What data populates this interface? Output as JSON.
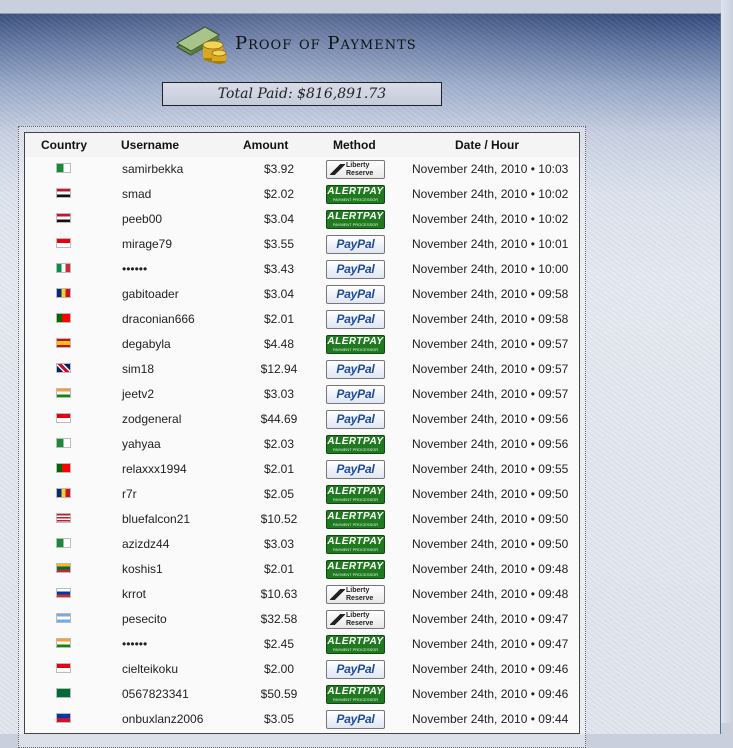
{
  "title": "Proof of Payments",
  "total_paid": "Total Paid: $816,891.73",
  "table": {
    "headers": {
      "country": "Country",
      "username": "Username",
      "amount": "Amount",
      "method": "Method",
      "date": "Date / Hour"
    },
    "methods": {
      "paypal": {
        "label": "PayPal"
      },
      "alertpay": {
        "label": "ALERTPAY",
        "sub": "PAYMENT PROCESSOR"
      },
      "liberty": {
        "label": "Liberty Reserve"
      }
    },
    "rows": [
      {
        "flag": "algeria",
        "username": "samirbekka",
        "amount": "$3.92",
        "method": "liberty",
        "date": "November 24th, 2010 • 10:03"
      },
      {
        "flag": "egypt",
        "username": "smad",
        "amount": "$2.02",
        "method": "alertpay",
        "date": "November 24th, 2010 • 10:02"
      },
      {
        "flag": "iraq",
        "username": "peeb00",
        "amount": "$3.04",
        "method": "alertpay",
        "date": "November 24th, 2010 • 10:02"
      },
      {
        "flag": "indonesia",
        "username": "mirage79",
        "amount": "$3.55",
        "method": "paypal",
        "date": "November 24th, 2010 • 10:01"
      },
      {
        "flag": "italy",
        "username": "••••••",
        "amount": "$3.43",
        "method": "paypal",
        "date": "November 24th, 2010 • 10:00"
      },
      {
        "flag": "romania",
        "username": "gabitoader",
        "amount": "$3.04",
        "method": "paypal",
        "date": "November 24th, 2010 • 09:58"
      },
      {
        "flag": "portugal",
        "username": "draconian666",
        "amount": "$2.01",
        "method": "paypal",
        "date": "November 24th, 2010 • 09:58"
      },
      {
        "flag": "spain",
        "username": "degabyla",
        "amount": "$4.48",
        "method": "alertpay",
        "date": "November 24th, 2010 • 09:57"
      },
      {
        "flag": "uk",
        "username": "sim18",
        "amount": "$12.94",
        "method": "paypal",
        "date": "November 24th, 2010 • 09:57"
      },
      {
        "flag": "india",
        "username": "jeetv2",
        "amount": "$3.03",
        "method": "paypal",
        "date": "November 24th, 2010 • 09:57"
      },
      {
        "flag": "indonesia",
        "username": "zodgeneral",
        "amount": "$44.69",
        "method": "paypal",
        "date": "November 24th, 2010 • 09:56"
      },
      {
        "flag": "algeria",
        "username": "yahyaa",
        "amount": "$2.03",
        "method": "alertpay",
        "date": "November 24th, 2010 • 09:56"
      },
      {
        "flag": "portugal",
        "username": "relaxxx1994",
        "amount": "$2.01",
        "method": "paypal",
        "date": "November 24th, 2010 • 09:55"
      },
      {
        "flag": "romania",
        "username": "r7r",
        "amount": "$2.05",
        "method": "alertpay",
        "date": "November 24th, 2010 • 09:50"
      },
      {
        "flag": "usa",
        "username": "bluefalcon21",
        "amount": "$10.52",
        "method": "alertpay",
        "date": "November 24th, 2010 • 09:50"
      },
      {
        "flag": "algeria",
        "username": "azizdz44",
        "amount": "$3.03",
        "method": "alertpay",
        "date": "November 24th, 2010 • 09:50"
      },
      {
        "flag": "lithuania",
        "username": "koshis1",
        "amount": "$2.01",
        "method": "alertpay",
        "date": "November 24th, 2010 • 09:48"
      },
      {
        "flag": "russia",
        "username": "krrot",
        "amount": "$10.63",
        "method": "liberty",
        "date": "November 24th, 2010 • 09:48"
      },
      {
        "flag": "argentina",
        "username": "pesecito",
        "amount": "$32.58",
        "method": "liberty",
        "date": "November 24th, 2010 • 09:47"
      },
      {
        "flag": "india",
        "username": "••••••",
        "amount": "$2.45",
        "method": "alertpay",
        "date": "November 24th, 2010 • 09:47"
      },
      {
        "flag": "indonesia",
        "username": "cielteikoku",
        "amount": "$2.00",
        "method": "paypal",
        "date": "November 24th, 2010 • 09:46"
      },
      {
        "flag": "saudi",
        "username": "0567823341",
        "amount": "$50.59",
        "method": "alertpay",
        "date": "November 24th, 2010 • 09:46"
      },
      {
        "flag": "philippines",
        "username": "onbuxlanz2006",
        "amount": "$3.05",
        "method": "paypal",
        "date": "November 24th, 2010 • 09:44"
      }
    ]
  },
  "flag_styles": {
    "algeria": "linear-gradient(90deg,#1a8a3a 0 50%,#ffffff 50% 100%)",
    "egypt": "linear-gradient(180deg,#ce1126 0 33%,#ffffff 33% 66%,#111 66%)",
    "iraq": "linear-gradient(180deg,#ce1126 0 33%,#ffffff 33% 66%,#111 66%)",
    "indonesia": "linear-gradient(180deg,#e70011 0 50%,#ffffff 50%)",
    "italy": "linear-gradient(90deg,#009246 0 33%,#ffffff 33% 66%,#ce2b37 66%)",
    "romania": "linear-gradient(90deg,#002b7f 0 33%,#fcd116 33% 66%,#ce1126 66%)",
    "portugal": "linear-gradient(90deg,#006600 0 40%,#ff0000 40%)",
    "spain": "linear-gradient(180deg,#c60b1e 0 25%,#ffc400 25% 75%,#c60b1e 75%)",
    "uk": "linear-gradient(45deg,#012169 0 30%,#ffffff 30% 40%,#c8102e 40% 60%,#ffffff 60% 70%,#012169 70%)",
    "india": "linear-gradient(180deg,#ff9933 0 33%,#ffffff 33% 66%,#138808 66%)",
    "usa": "repeating-linear-gradient(180deg,#b22234 0 1.5px,#ffffff 1.5px 3px)",
    "lithuania": "linear-gradient(180deg,#fdb913 0 33%,#006a44 33% 66%,#c1272d 66%)",
    "russia": "linear-gradient(180deg,#ffffff 0 33%,#0039a6 33% 66%,#d52b1e 66%)",
    "argentina": "linear-gradient(180deg,#74acdf 0 33%,#ffffff 33% 66%,#74acdf 66%)",
    "saudi": "linear-gradient(180deg,#006c35,#006c35)",
    "philippines": "linear-gradient(180deg,#0038a8 0 50%,#ce1126 50%)"
  }
}
